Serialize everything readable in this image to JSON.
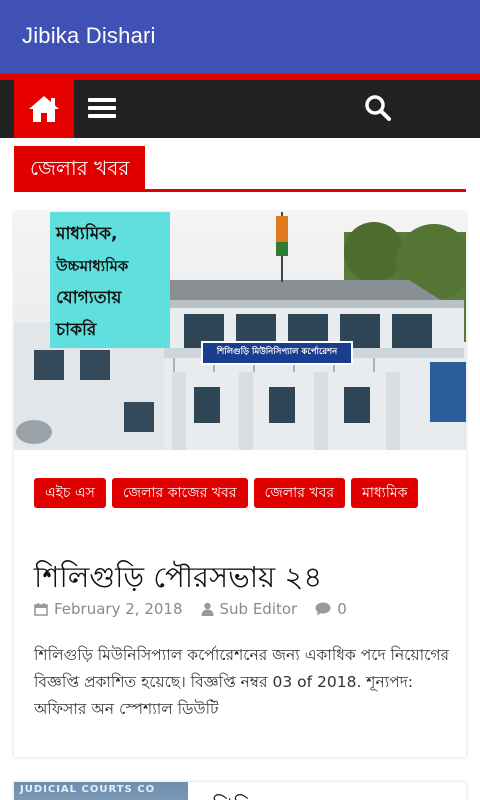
{
  "app": {
    "title": "Jibika Dishari"
  },
  "nav": {
    "home_icon": "home-icon",
    "menu_icon": "hamburger-menu-icon",
    "search_icon": "search-icon"
  },
  "section": {
    "title": "জেলার খবর"
  },
  "post": {
    "image_text": {
      "line1": "মাধ্যমিক,",
      "line2": "উচ্চমাধ্যমিক",
      "line3": "যোগ্যতায়",
      "line4": "চাকরি",
      "sign": "শিলিগুড়ি মিউনিসিপ্যাল কর্পোরেশন"
    },
    "tags": [
      "এইচ এস",
      "জেলার কাজের খবর",
      "জেলার খবর",
      "মাধ্যমিক"
    ],
    "title": "শিলিগুড়ি পৌরসভায় ২৪",
    "date": "February 2, 2018",
    "author": "Sub Editor",
    "comments": "0",
    "excerpt": "শিলিগুড়ি মিউনিসিপ্যাল কর্পোরেশনের জন্য একাধিক পদে নিয়োগের বিজ্ঞপ্তি প্রকাশিত হয়েছে। বিজ্ঞপ্তি নম্বর 03 of 2018. শূন্যপদ: অফিসার অন স্পেশ্যাল ডিউটি"
  },
  "next_post": {
    "image_caption": "JUDICIAL COURTS CO",
    "title_partial": "শিলিগু"
  },
  "colors": {
    "appbar": "#3f51b5",
    "accent": "#e00000",
    "nav": "#222222"
  }
}
